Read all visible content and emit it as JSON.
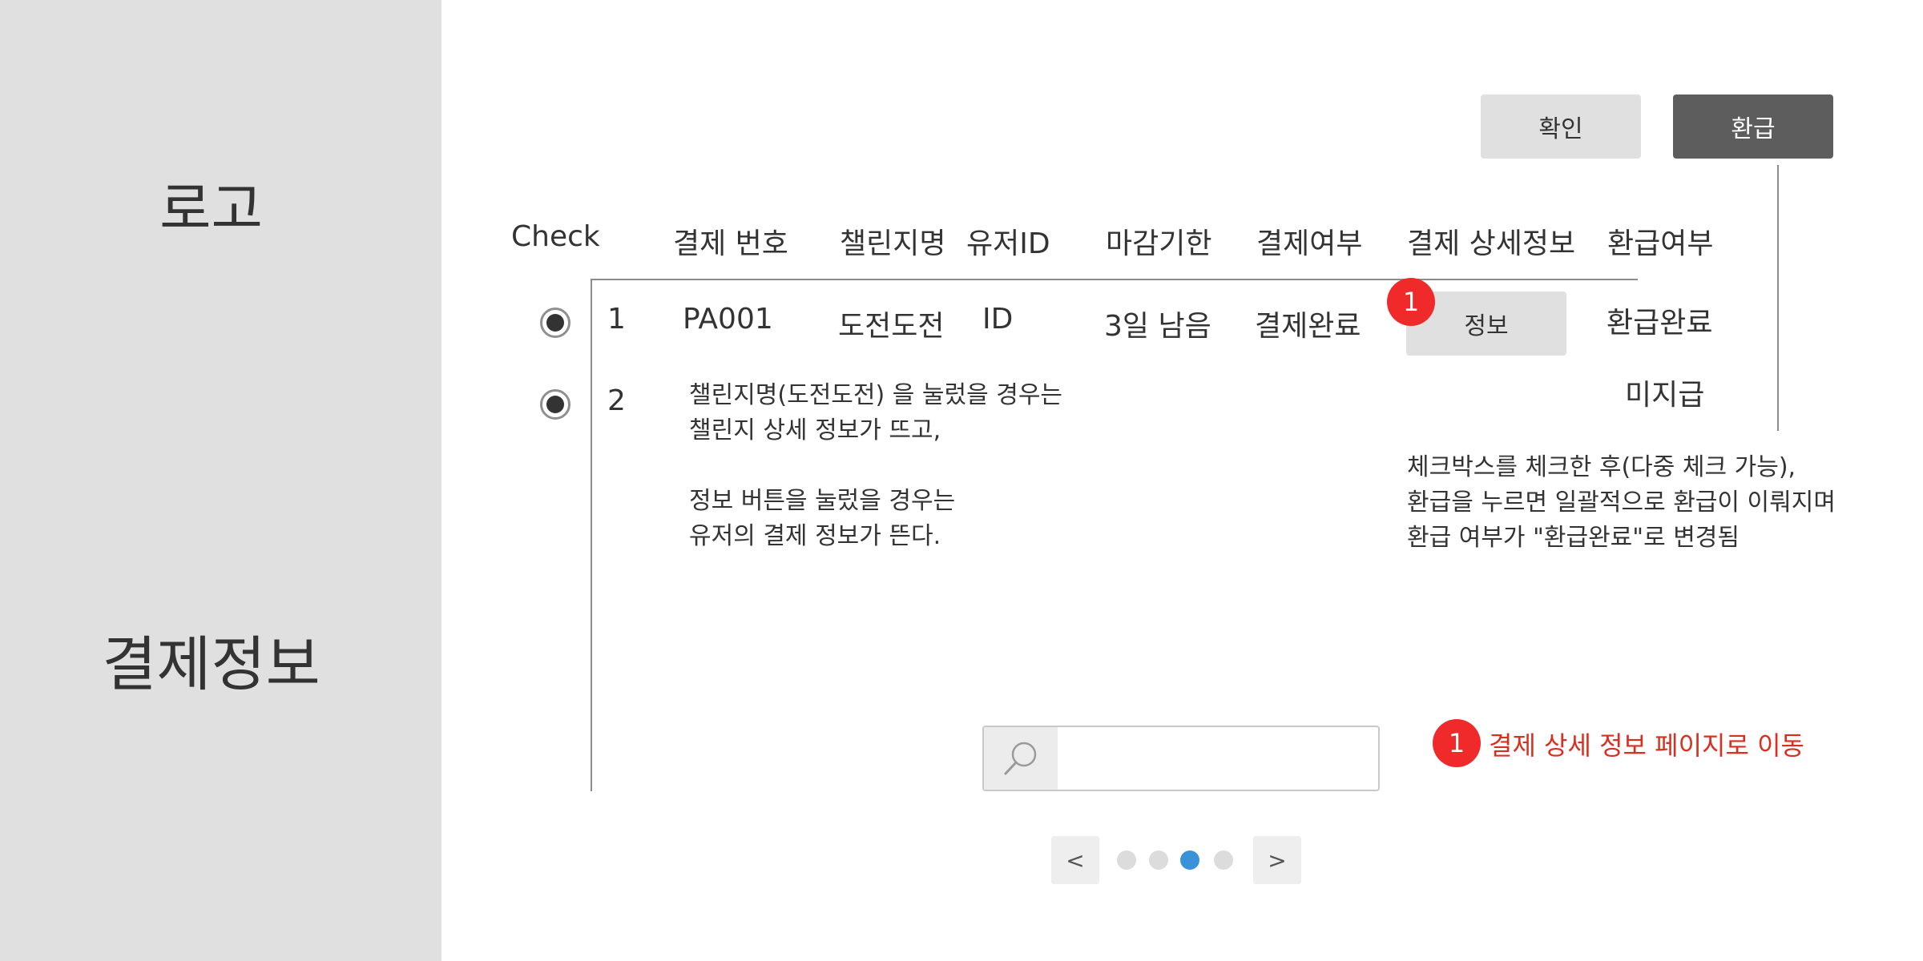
{
  "sidebar": {
    "logo": "로고",
    "menu_payment": "결제정보"
  },
  "toolbar": {
    "confirm_label": "확인",
    "refund_label": "환급"
  },
  "table": {
    "headers": [
      "Check",
      "결제 번호",
      "챌린지명",
      "유저ID",
      "마감기한",
      "결제여부",
      "결제 상세정보",
      "환급여부"
    ],
    "rows": [
      {
        "checked": true,
        "num": "1",
        "payment_id": "PA001",
        "challenge": "도전도전",
        "user_id": "ID",
        "deadline": "3일 남음",
        "payment_status": "결제완료",
        "detail_button": "정보",
        "refund_status": "환급완료"
      },
      {
        "checked": true,
        "num": "2",
        "refund_status": "미지급"
      }
    ]
  },
  "annotations": {
    "challenge_note": [
      "챌린지명(도전도전) 을 눌렀을 경우는",
      "챌린지 상세 정보가 뜨고,",
      "정보 버튼을 눌렀을 경우는",
      "유저의 결제 정보가 뜬다."
    ],
    "refund_note": [
      "체크박스를 체크한 후(다중 체크 가능),",
      "환급을 누르면 일괄적으로 환급이 이뤄지며",
      "환급 여부가 \"환급완료\"로 변경됨"
    ],
    "badge_number": "1",
    "legend_badge": "1",
    "legend_text": "결제 상세 정보 페이지로 이동"
  },
  "search": {
    "placeholder": "",
    "value": "",
    "icon": "search-icon"
  },
  "pagination": {
    "prev_label": "<",
    "next_label": ">",
    "page_count": 4,
    "current_page": 3
  },
  "colors": {
    "sidebar_bg": "#e0e0e0",
    "refund_button_bg": "#5d5d5d",
    "badge_red": "#f02a2a",
    "legend_text": "#d83020",
    "active_page_dot": "#3a93d8"
  }
}
